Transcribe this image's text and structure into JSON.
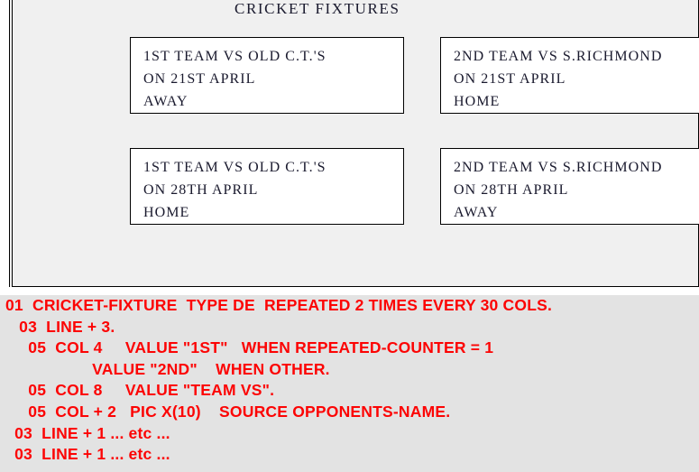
{
  "report": {
    "title": "CRICKET FIXTURES",
    "fixtures": [
      {
        "team_line": "1ST TEAM VS OLD C.T.'S",
        "date_line": "ON 21ST APRIL",
        "venue_line": "AWAY"
      },
      {
        "team_line": "2ND TEAM VS S.RICHMOND",
        "date_line": "ON 21ST APRIL",
        "venue_line": "HOME"
      },
      {
        "team_line": "1ST TEAM VS OLD C.T.'S",
        "date_line": "ON 28TH APRIL",
        "venue_line": "HOME"
      },
      {
        "team_line": "2ND TEAM VS S.RICHMOND",
        "date_line": "ON 28TH APRIL",
        "venue_line": "AWAY"
      }
    ]
  },
  "code": {
    "color": "#fc0404",
    "background": "#e3e3e3",
    "lines": [
      "01  CRICKET-FIXTURE  TYPE DE  REPEATED 2 TIMES EVERY 30 COLS.",
      "   03  LINE + 3.",
      "     05  COL 4     VALUE \"1ST\"   WHEN REPEATED-COUNTER = 1",
      "                   VALUE \"2ND\"    WHEN OTHER.",
      "     05  COL 8     VALUE \"TEAM VS\".",
      "     05  COL + 2   PIC X(10)    SOURCE OPPONENTS-NAME.",
      "  03  LINE + 1 ... etc ...",
      "  03  LINE + 1 ... etc ..."
    ]
  }
}
